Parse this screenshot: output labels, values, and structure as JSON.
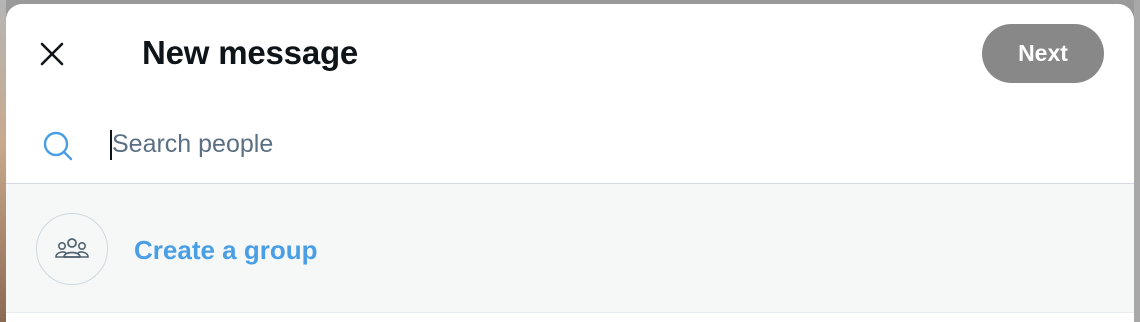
{
  "modal": {
    "title": "New message",
    "next_label": "Next"
  },
  "search": {
    "placeholder": "Search people",
    "value": ""
  },
  "create_group": {
    "label": "Create a group"
  },
  "icons": {
    "close": "close-icon",
    "search": "search-icon",
    "group": "group-icon"
  },
  "colors": {
    "accent": "#4a9fe4",
    "next_button_disabled": "#888888",
    "title_text": "#0f1419",
    "placeholder_text": "#5b7083",
    "row_highlight": "#f6f8f8"
  }
}
